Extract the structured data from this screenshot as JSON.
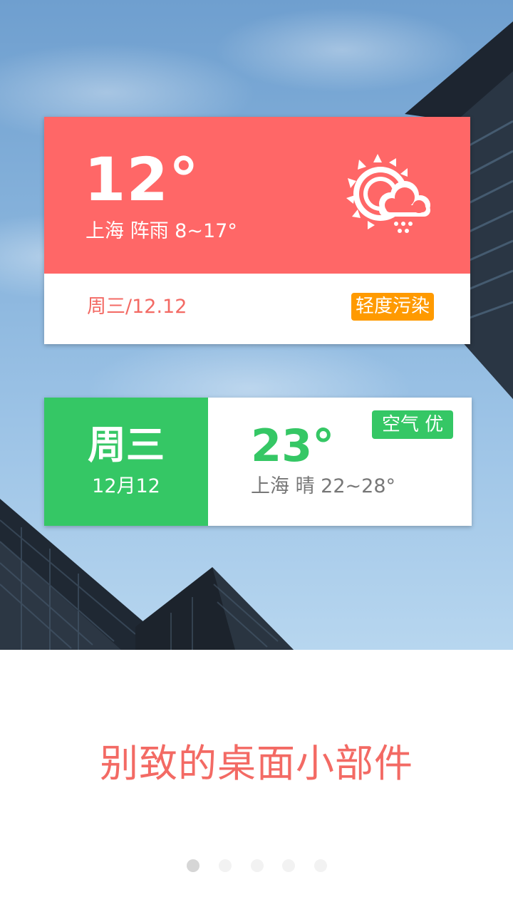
{
  "widget1": {
    "temperature": "12°",
    "description": "上海 阵雨 8~17°",
    "weather_icon": "sun-cloud-rain-icon",
    "date": "周三/12.12",
    "aqi_badge": "轻度污染",
    "colors": {
      "header": "#ff6767",
      "badge": "#ff9a00",
      "date_text": "#f36a64"
    }
  },
  "widget2": {
    "day": "周三",
    "date": "12月12",
    "temperature": "23°",
    "description": "上海 晴 22~28°",
    "aqi_badge": "空气 优",
    "colors": {
      "accent": "#35c765",
      "desc_text": "#777777"
    }
  },
  "caption": "别致的桌面小部件",
  "pagination": {
    "total": 5,
    "active_index": 0
  }
}
